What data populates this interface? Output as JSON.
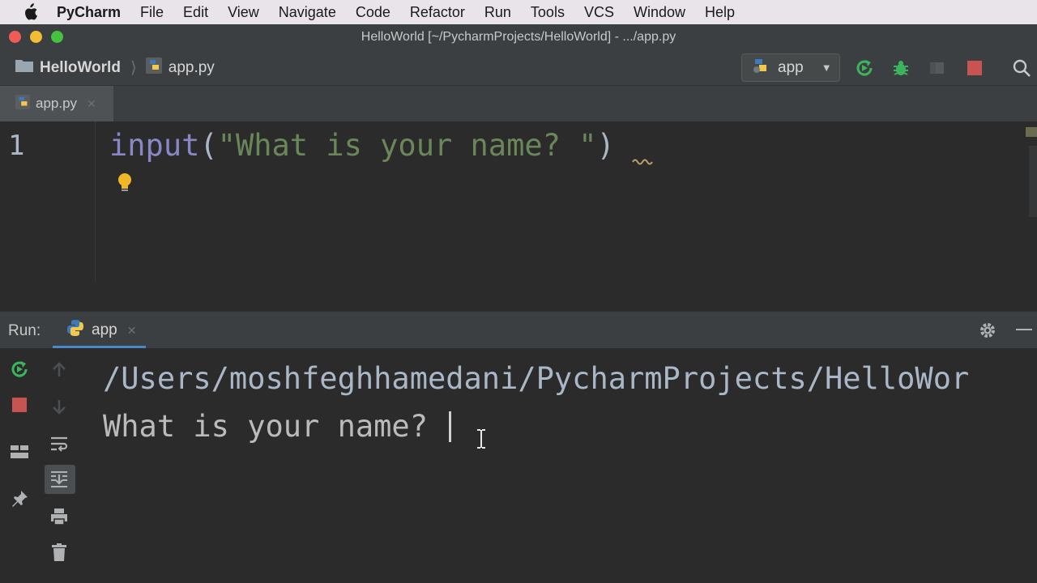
{
  "menubar": {
    "app_name": "PyCharm",
    "items": [
      "File",
      "Edit",
      "View",
      "Navigate",
      "Code",
      "Refactor",
      "Run",
      "Tools",
      "VCS",
      "Window",
      "Help"
    ]
  },
  "window": {
    "title": "HelloWorld [~/PycharmProjects/HelloWorld] - .../app.py"
  },
  "navbar": {
    "project": "HelloWorld",
    "file": "app.py",
    "run_config": "app"
  },
  "editor": {
    "tab_label": "app.py",
    "line_number": "1",
    "code": {
      "function": "input",
      "open_paren": "(",
      "string": "\"What is your name? \"",
      "close_paren": ")"
    }
  },
  "run_panel": {
    "label": "Run:",
    "tab_label": "app",
    "console": {
      "path_line": "/Users/moshfeghhamedani/PycharmProjects/HelloWor",
      "prompt_line": "What is your name? "
    }
  },
  "colors": {
    "editor_bg": "#2b2b2b",
    "panel_bg": "#3c3f41",
    "string_green": "#6a8759",
    "builtin_purple": "#8888c6",
    "run_green": "#3cb45e",
    "stop_red": "#c75450",
    "tab_underline": "#4a88c7"
  }
}
